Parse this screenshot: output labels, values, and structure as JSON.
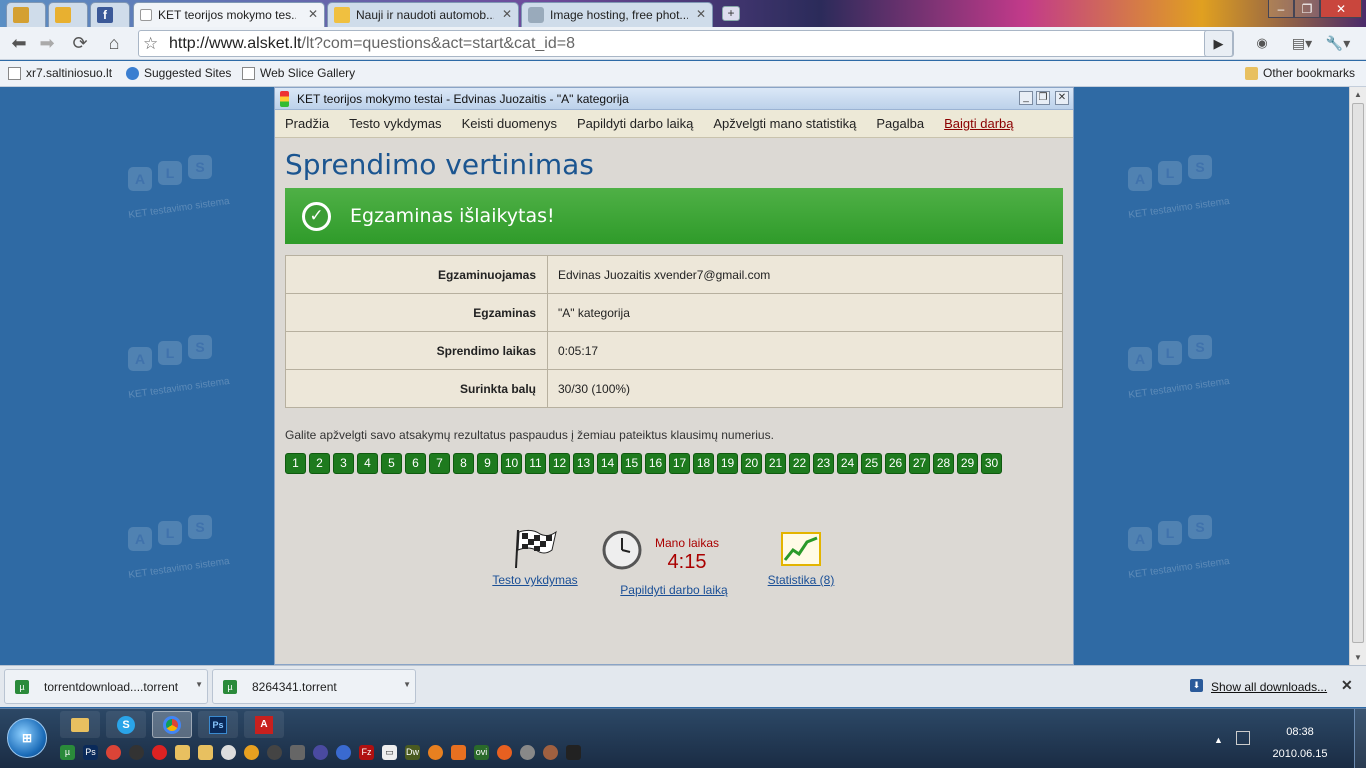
{
  "browser": {
    "tabs": [
      {
        "label": ""
      },
      {
        "label": ""
      },
      {
        "label": ""
      },
      {
        "label": "KET teorijos mokymo tes..."
      },
      {
        "label": "Nauji ir naudoti automob..."
      },
      {
        "label": "Image hosting, free phot..."
      }
    ],
    "url_domain": "http://www.alsket.lt",
    "url_path": "/lt?com=questions&act=start&cat_id=8",
    "bookmarks": [
      "xr7.saltiniosuo.lt",
      "Suggested Sites",
      "Web Slice Gallery"
    ],
    "other_bookmarks": "Other bookmarks"
  },
  "app": {
    "window_title": "KET teorijos mokymo testai - Edvinas Juozaitis - \"A\" kategorija",
    "menu": [
      "Pradžia",
      "Testo vykdymas",
      "Keisti duomenys",
      "Papildyti darbo laiką",
      "Apžvelgti mano statistiką",
      "Pagalba"
    ],
    "menu_quit": "Baigti darbą",
    "page_title": "Sprendimo vertinimas",
    "banner_text": "Egzaminas išlaikytas!",
    "info_rows": [
      {
        "label": "Egzaminuojamas",
        "value": "Edvinas Juozaitis xvender7@gmail.com"
      },
      {
        "label": "Egzaminas",
        "value": "\"A\" kategorija"
      },
      {
        "label": "Sprendimo laikas",
        "value": "0:05:17"
      },
      {
        "label": "Surinkta balų",
        "value": "30/30 (100%)"
      }
    ],
    "hint": "Galite apžvelgti savo atsakymų rezultatus paspaudus į žemiau pateiktus klausimų numerius.",
    "question_numbers": [
      "1",
      "2",
      "3",
      "4",
      "5",
      "6",
      "7",
      "8",
      "9",
      "10",
      "11",
      "12",
      "13",
      "14",
      "15",
      "16",
      "17",
      "18",
      "19",
      "20",
      "21",
      "22",
      "23",
      "24",
      "25",
      "26",
      "27",
      "28",
      "29",
      "30"
    ],
    "my_time_label": "Mano laikas",
    "my_time_value": "4:15",
    "links": [
      "Testo vykdymas",
      "Papildyti darbo laiką",
      "Statistika (8)"
    ],
    "watermark_letters": [
      "A",
      "L",
      "S"
    ],
    "watermark_text": "KET testavimo sistema"
  },
  "downloads": {
    "items": [
      "torrentdownload....torrent",
      "8264341.torrent"
    ],
    "show_all": "Show all downloads..."
  },
  "taskbar": {
    "time": "08:38",
    "date": "2010.06.15"
  },
  "colors": {
    "background": "#2f6aa4",
    "banner": "#3fa43a",
    "question_button": "#1e7a1e",
    "title": "#1b5590"
  }
}
